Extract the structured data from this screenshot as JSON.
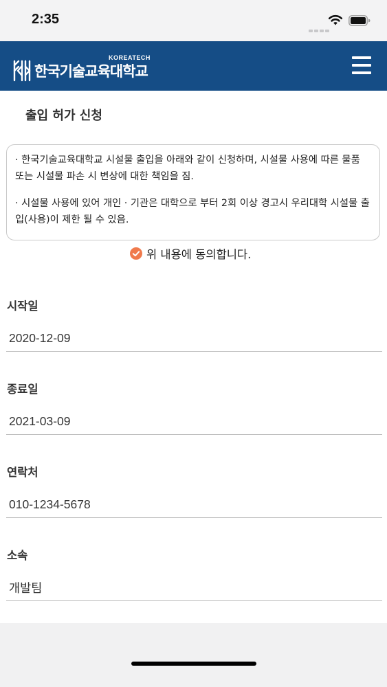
{
  "status_bar": {
    "time": "2:35",
    "icons": [
      "signal-icon",
      "wifi-icon",
      "battery-icon"
    ]
  },
  "header": {
    "logo_icon": "koreatech-logo-icon",
    "logo_subtitle": "KOREATECH",
    "logo_title": "한국기술교육대학교",
    "menu_icon": "hamburger-menu-icon",
    "background_color": "#154d86"
  },
  "form": {
    "title": "출입 허가 신청",
    "notice": {
      "paragraph1": "· 한국기술교육대학교 시설물 출입을 아래와 같이 신청하며, 시설물 사용에 따른 물품 또는 시설물 파손 시 변상에 대한 책임을 짐.",
      "paragraph2": "· 시설물 사용에 있어 개인 · 기관은 대학으로 부터 2회 이상 경고시 우리대학 시설물 출입(사용)이 제한 될 수 있음."
    },
    "agree": {
      "label": "위 내용에 동의합니다.",
      "checked": true,
      "check_color": "#f07a4c"
    },
    "fields": [
      {
        "label": "시작일",
        "value": "2020-12-09"
      },
      {
        "label": "종료일",
        "value": "2021-03-09"
      },
      {
        "label": "연락처",
        "value": "010-1234-5678"
      },
      {
        "label": "소속",
        "value": "개발팀"
      }
    ]
  }
}
